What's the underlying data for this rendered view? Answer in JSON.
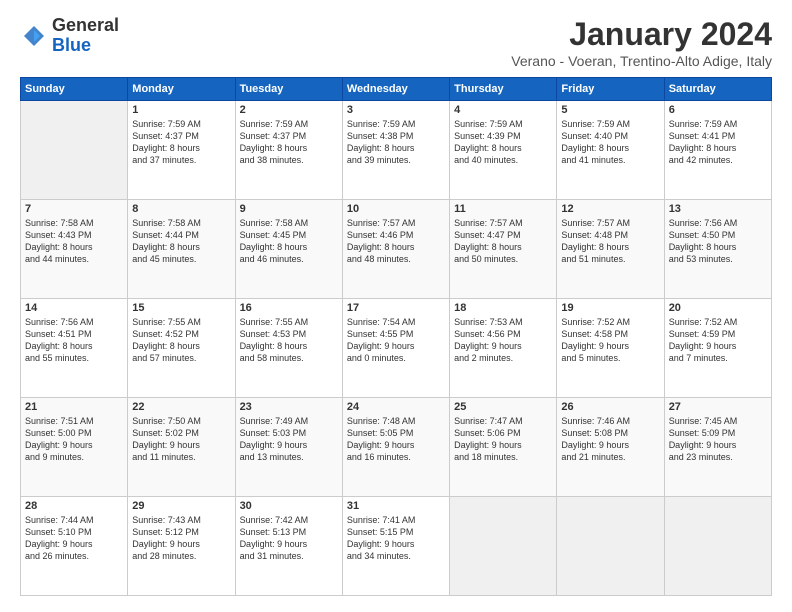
{
  "logo": {
    "general": "General",
    "blue": "Blue"
  },
  "header": {
    "title": "January 2024",
    "location": "Verano - Voeran, Trentino-Alto Adige, Italy"
  },
  "weekdays": [
    "Sunday",
    "Monday",
    "Tuesday",
    "Wednesday",
    "Thursday",
    "Friday",
    "Saturday"
  ],
  "weeks": [
    [
      {
        "day": "",
        "content": ""
      },
      {
        "day": "1",
        "content": "Sunrise: 7:59 AM\nSunset: 4:37 PM\nDaylight: 8 hours\nand 37 minutes."
      },
      {
        "day": "2",
        "content": "Sunrise: 7:59 AM\nSunset: 4:37 PM\nDaylight: 8 hours\nand 38 minutes."
      },
      {
        "day": "3",
        "content": "Sunrise: 7:59 AM\nSunset: 4:38 PM\nDaylight: 8 hours\nand 39 minutes."
      },
      {
        "day": "4",
        "content": "Sunrise: 7:59 AM\nSunset: 4:39 PM\nDaylight: 8 hours\nand 40 minutes."
      },
      {
        "day": "5",
        "content": "Sunrise: 7:59 AM\nSunset: 4:40 PM\nDaylight: 8 hours\nand 41 minutes."
      },
      {
        "day": "6",
        "content": "Sunrise: 7:59 AM\nSunset: 4:41 PM\nDaylight: 8 hours\nand 42 minutes."
      }
    ],
    [
      {
        "day": "7",
        "content": "Sunrise: 7:58 AM\nSunset: 4:43 PM\nDaylight: 8 hours\nand 44 minutes."
      },
      {
        "day": "8",
        "content": "Sunrise: 7:58 AM\nSunset: 4:44 PM\nDaylight: 8 hours\nand 45 minutes."
      },
      {
        "day": "9",
        "content": "Sunrise: 7:58 AM\nSunset: 4:45 PM\nDaylight: 8 hours\nand 46 minutes."
      },
      {
        "day": "10",
        "content": "Sunrise: 7:57 AM\nSunset: 4:46 PM\nDaylight: 8 hours\nand 48 minutes."
      },
      {
        "day": "11",
        "content": "Sunrise: 7:57 AM\nSunset: 4:47 PM\nDaylight: 8 hours\nand 50 minutes."
      },
      {
        "day": "12",
        "content": "Sunrise: 7:57 AM\nSunset: 4:48 PM\nDaylight: 8 hours\nand 51 minutes."
      },
      {
        "day": "13",
        "content": "Sunrise: 7:56 AM\nSunset: 4:50 PM\nDaylight: 8 hours\nand 53 minutes."
      }
    ],
    [
      {
        "day": "14",
        "content": "Sunrise: 7:56 AM\nSunset: 4:51 PM\nDaylight: 8 hours\nand 55 minutes."
      },
      {
        "day": "15",
        "content": "Sunrise: 7:55 AM\nSunset: 4:52 PM\nDaylight: 8 hours\nand 57 minutes."
      },
      {
        "day": "16",
        "content": "Sunrise: 7:55 AM\nSunset: 4:53 PM\nDaylight: 8 hours\nand 58 minutes."
      },
      {
        "day": "17",
        "content": "Sunrise: 7:54 AM\nSunset: 4:55 PM\nDaylight: 9 hours\nand 0 minutes."
      },
      {
        "day": "18",
        "content": "Sunrise: 7:53 AM\nSunset: 4:56 PM\nDaylight: 9 hours\nand 2 minutes."
      },
      {
        "day": "19",
        "content": "Sunrise: 7:52 AM\nSunset: 4:58 PM\nDaylight: 9 hours\nand 5 minutes."
      },
      {
        "day": "20",
        "content": "Sunrise: 7:52 AM\nSunset: 4:59 PM\nDaylight: 9 hours\nand 7 minutes."
      }
    ],
    [
      {
        "day": "21",
        "content": "Sunrise: 7:51 AM\nSunset: 5:00 PM\nDaylight: 9 hours\nand 9 minutes."
      },
      {
        "day": "22",
        "content": "Sunrise: 7:50 AM\nSunset: 5:02 PM\nDaylight: 9 hours\nand 11 minutes."
      },
      {
        "day": "23",
        "content": "Sunrise: 7:49 AM\nSunset: 5:03 PM\nDaylight: 9 hours\nand 13 minutes."
      },
      {
        "day": "24",
        "content": "Sunrise: 7:48 AM\nSunset: 5:05 PM\nDaylight: 9 hours\nand 16 minutes."
      },
      {
        "day": "25",
        "content": "Sunrise: 7:47 AM\nSunset: 5:06 PM\nDaylight: 9 hours\nand 18 minutes."
      },
      {
        "day": "26",
        "content": "Sunrise: 7:46 AM\nSunset: 5:08 PM\nDaylight: 9 hours\nand 21 minutes."
      },
      {
        "day": "27",
        "content": "Sunrise: 7:45 AM\nSunset: 5:09 PM\nDaylight: 9 hours\nand 23 minutes."
      }
    ],
    [
      {
        "day": "28",
        "content": "Sunrise: 7:44 AM\nSunset: 5:10 PM\nDaylight: 9 hours\nand 26 minutes."
      },
      {
        "day": "29",
        "content": "Sunrise: 7:43 AM\nSunset: 5:12 PM\nDaylight: 9 hours\nand 28 minutes."
      },
      {
        "day": "30",
        "content": "Sunrise: 7:42 AM\nSunset: 5:13 PM\nDaylight: 9 hours\nand 31 minutes."
      },
      {
        "day": "31",
        "content": "Sunrise: 7:41 AM\nSunset: 5:15 PM\nDaylight: 9 hours\nand 34 minutes."
      },
      {
        "day": "",
        "content": ""
      },
      {
        "day": "",
        "content": ""
      },
      {
        "day": "",
        "content": ""
      }
    ]
  ]
}
